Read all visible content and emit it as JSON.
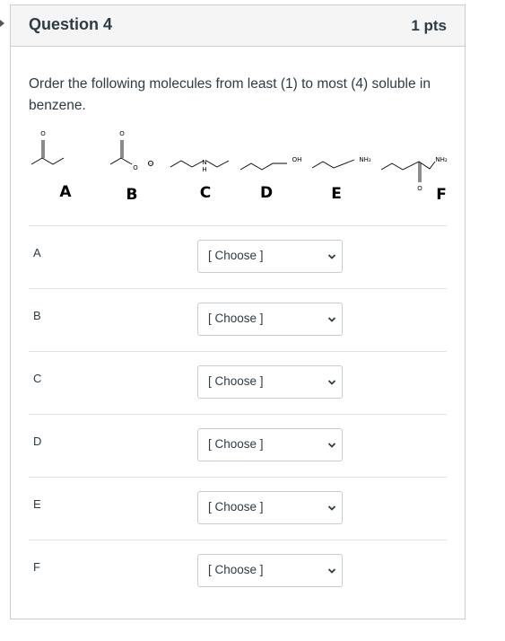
{
  "question": {
    "title": "Question 4",
    "points": "1 pts",
    "prompt": "Order the following molecules from least (1) to most (4) soluble in benzene."
  },
  "molecules": {
    "labels": [
      "A",
      "B",
      "C",
      "D",
      "E",
      "F"
    ],
    "atoms": {
      "a_oxygen": "O",
      "b_oxygen_top": "O",
      "b_oxygen_anion": "O",
      "b_minus": "−",
      "c_nitrogen": "N",
      "c_hydrogen": "H",
      "d_hydroxyl": "OH",
      "e_amine": "NH₂",
      "f_amine": "NH₂",
      "f_oxygen": "O"
    }
  },
  "answer_rows": [
    {
      "label": "A",
      "selected": "[ Choose ]"
    },
    {
      "label": "B",
      "selected": "[ Choose ]"
    },
    {
      "label": "C",
      "selected": "[ Choose ]"
    },
    {
      "label": "D",
      "selected": "[ Choose ]"
    },
    {
      "label": "E",
      "selected": "[ Choose ]"
    },
    {
      "label": "F",
      "selected": "[ Choose ]"
    }
  ],
  "icons": {
    "dropdown": "chevron-down-icon",
    "edge": "caret-right-icon"
  }
}
